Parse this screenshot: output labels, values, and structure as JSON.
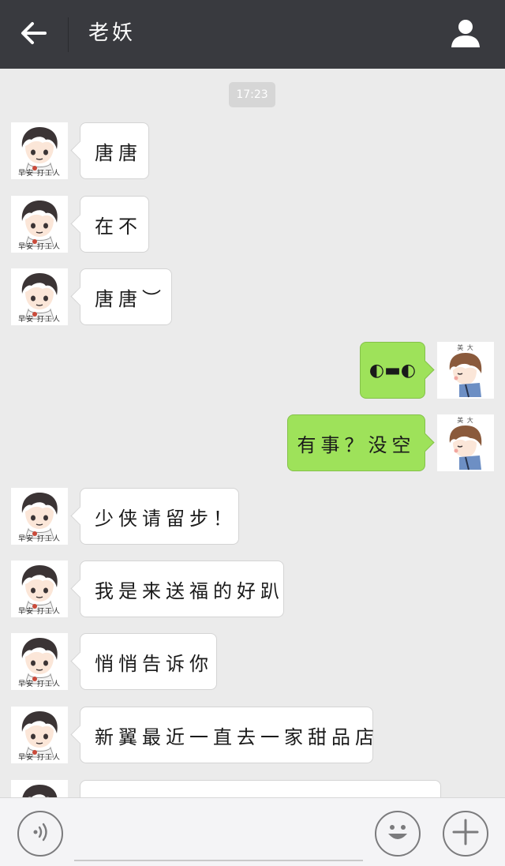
{
  "header": {
    "title": "老妖",
    "back_icon": "back-arrow-icon",
    "profile_icon": "person-icon"
  },
  "timestamp": "17:23",
  "messages": [
    {
      "side": "in",
      "text": "唐唐",
      "avatar": "boy-avatar"
    },
    {
      "side": "in",
      "text": "在不",
      "avatar": "boy-avatar"
    },
    {
      "side": "in",
      "text": "唐唐︶",
      "avatar": "boy-avatar"
    },
    {
      "side": "out",
      "text": "◐▬◐",
      "avatar": "girl-avatar"
    },
    {
      "side": "out",
      "text": "有事？没空",
      "avatar": "girl-avatar"
    },
    {
      "side": "in",
      "text": "少侠请留步！",
      "avatar": "boy-avatar"
    },
    {
      "side": "in",
      "text": "我是来送福的好趴",
      "avatar": "boy-avatar"
    },
    {
      "side": "in",
      "text": "悄悄告诉你",
      "avatar": "boy-avatar"
    },
    {
      "side": "in",
      "text": "新翼最近一直去一家甜品店",
      "avatar": "boy-avatar"
    }
  ],
  "avatars": {
    "boy_caption": "早安 打工人",
    "girl_caption": "美 大"
  },
  "input_bar": {
    "placeholder": "",
    "voice_icon": "voice-icon",
    "emoji_icon": "emoji-icon",
    "plus_icon": "plus-icon"
  },
  "colors": {
    "header_bg": "#393a3f",
    "chat_bg": "#ebebeb",
    "outgoing_bubble": "#9ee25a",
    "incoming_bubble": "#ffffff"
  }
}
